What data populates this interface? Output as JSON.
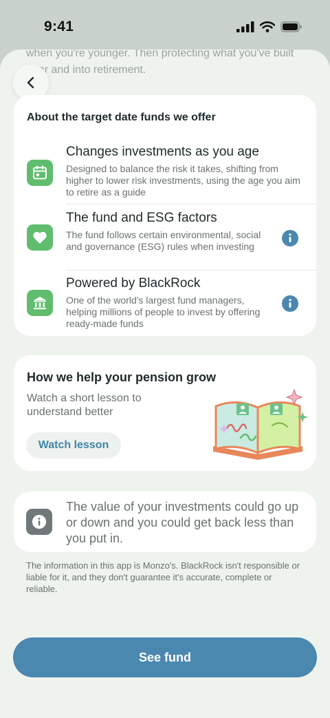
{
  "status_bar": {
    "time": "9:41"
  },
  "peek_text": "when you're younger. Then protecting what you've built near and into retirement.",
  "target_date_card": {
    "title": "About the target date funds we offer",
    "rows": [
      {
        "icon": "calendar-icon",
        "title": "Changes investments as you age",
        "description": "Designed to balance the risk it takes, shifting from higher to lower risk investments, using the age you aim to retire as a guide"
      },
      {
        "icon": "heart-icon",
        "title": "The fund and ESG factors",
        "description": "The fund follows certain environmental, social and governance (ESG) rules when investing"
      },
      {
        "icon": "bank-icon",
        "title": "Powered by BlackRock",
        "description": "One of the world's largest fund managers, helping millions of people to invest by offering ready-made funds"
      }
    ]
  },
  "lesson_card": {
    "title": "How we help your pension grow",
    "description": "Watch a short lesson to understand better",
    "button_label": "Watch lesson"
  },
  "warning_card": {
    "text": "The value of your investments could go up or down and you could get back less than you put in."
  },
  "disclaimer": "The information in this app is Monzo's. BlackRock isn't responsible or liable for it, and they don't guarantee it's accurate, complete or reliable.",
  "cta_label": "See fund",
  "colors": {
    "accent": "#4b88b0",
    "icon_green": "#5fbd6d",
    "info_blue": "#4b88b0",
    "background": "#eef3ee"
  }
}
